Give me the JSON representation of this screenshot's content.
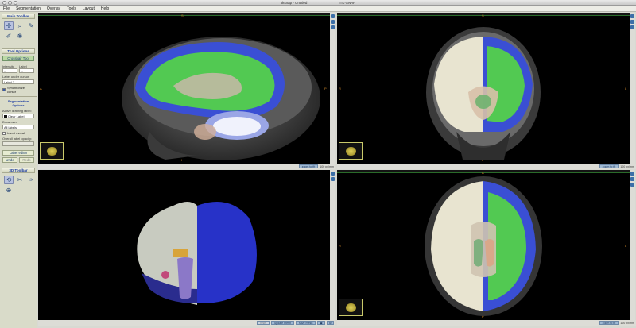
{
  "window": {
    "title": "itksnap - Untitled",
    "app_title": "ITK-SNAP"
  },
  "menu": [
    "File",
    "Segmentation",
    "Overlay",
    "Tools",
    "Layout",
    "Help"
  ],
  "sidebar": {
    "main_toolbar_title": "Main Toolbar",
    "tools": [
      {
        "icon": "crosshair-icon",
        "glyph": "✢",
        "active": true
      },
      {
        "icon": "zoom-icon",
        "glyph": "⌕",
        "active": false
      },
      {
        "icon": "polygon-icon",
        "glyph": "✎",
        "active": false
      },
      {
        "icon": "paintbrush-icon",
        "glyph": "✐",
        "active": false
      },
      {
        "icon": "snake-icon",
        "glyph": "❋",
        "active": false
      }
    ],
    "tool_options_title": "Tool Options",
    "crosshair_mode": "Crosshair Tool",
    "intensity_label": "Intensity",
    "label_label": "Label",
    "intensity_value": "...",
    "label_value": "...",
    "label_under_cursor": "Label under cursor",
    "label_under_cursor_value": "Label 3",
    "auto_cursor": "Synchronize cursor",
    "segmentation_options_title": "Segmentation Options",
    "active_label_heading": "Active drawing label:",
    "active_label_value": "Clear Label",
    "draw_over_heading": "Draw over:",
    "draw_over_value": "All labels",
    "invert_label": "Invert overall",
    "overall_opacity": "Overall label opacity:",
    "label_editor_btn": "Label editor",
    "undo_btn": "Undo",
    "redo_btn": "Redo",
    "tools3d_title": "3D Toolbar"
  },
  "views": {
    "sagittal": {
      "top_label": "S",
      "bottom_label": "I",
      "left_label": "A",
      "right_label": "P",
      "zoom_btn": "zoom to fit",
      "zoom_val": "100 px/mm"
    },
    "coronal": {
      "top_label": "S",
      "bottom_label": "I",
      "left_label": "R",
      "right_label": "L",
      "zoom_btn": "zoom to fit",
      "zoom_val": "100 px/mm"
    },
    "render3d": {
      "reset_btn": "reset",
      "update_btn": "update mesh",
      "save_btn": "save mesh"
    },
    "axial": {
      "top_label": "A",
      "bottom_label": "P",
      "left_label": "R",
      "right_label": "L",
      "zoom_btn": "zoom to fit",
      "zoom_val": "100 px/mm"
    }
  },
  "colors": {
    "segmentation_green": "#52c952",
    "segmentation_blue": "#3a4fd4",
    "background": "#000000",
    "accent": "#1a3aa0"
  }
}
